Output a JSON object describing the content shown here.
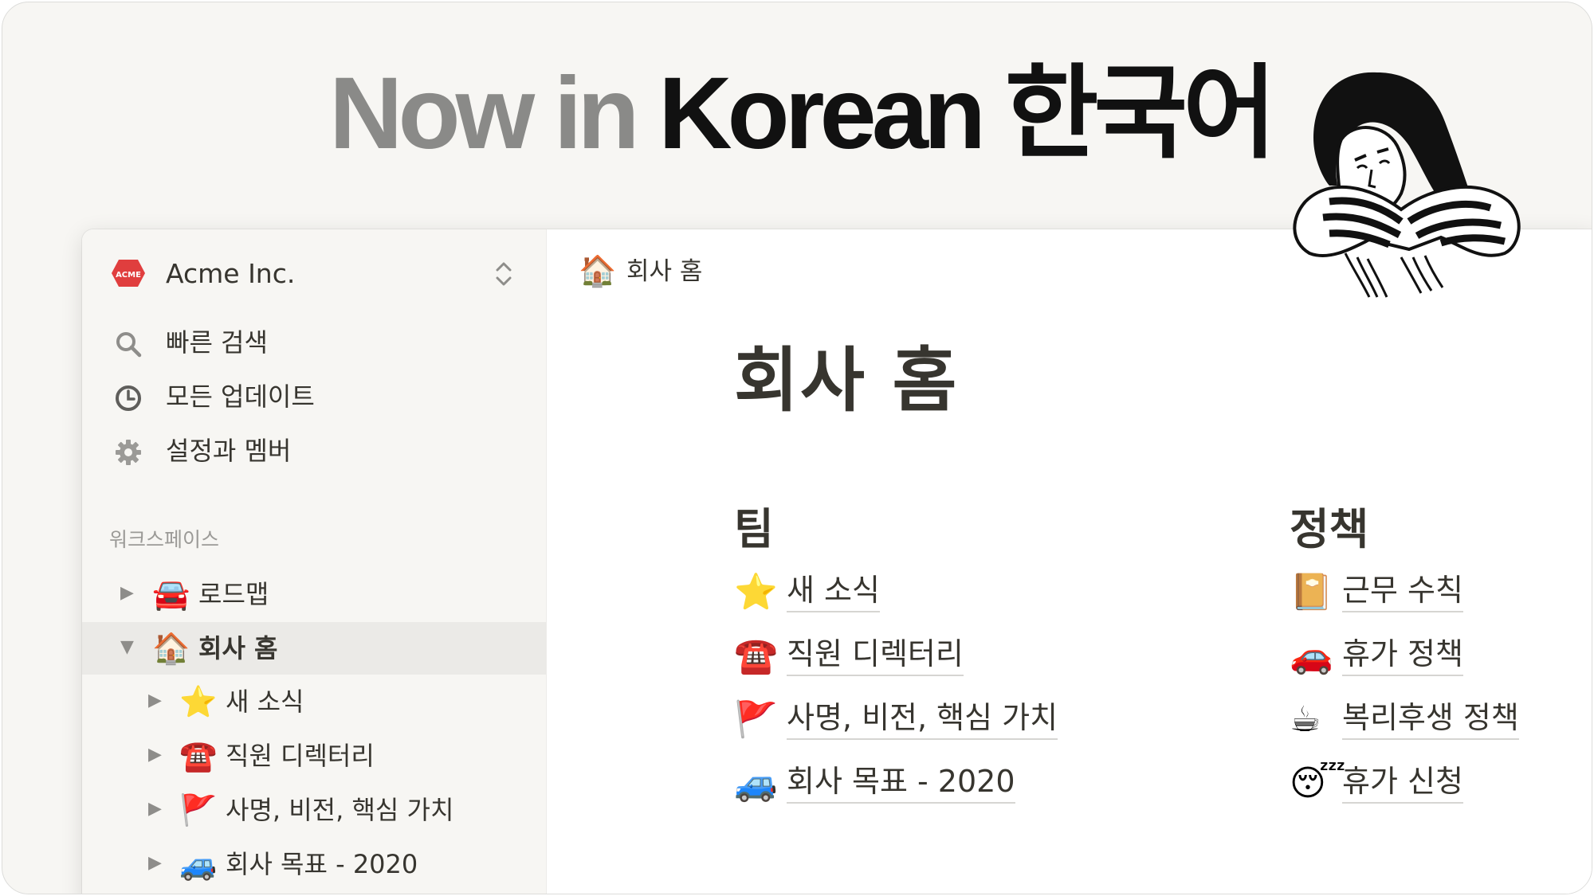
{
  "headline": {
    "part_grey": "Now in ",
    "part_black": "Korean 한국어"
  },
  "workspace": {
    "logo_text": "ACME",
    "name": "Acme Inc."
  },
  "sidebar": {
    "menu": [
      {
        "label": "빠른 검색",
        "icon": "search-icon"
      },
      {
        "label": "모든 업데이트",
        "icon": "clock-icon"
      },
      {
        "label": "설정과 멤버",
        "icon": "gear-icon"
      }
    ],
    "section_label": "워크스페이스",
    "tree": [
      {
        "emoji": "🚘",
        "label": "로드맵",
        "toggle": "▶",
        "active": false
      },
      {
        "emoji": "🏠",
        "label": "회사 홈",
        "toggle": "▼",
        "active": true
      },
      {
        "emoji": "⭐",
        "label": "새 소식",
        "toggle": "▶",
        "active": false
      },
      {
        "emoji": "☎️",
        "label": "직원 디렉터리",
        "toggle": "▶",
        "active": false
      },
      {
        "emoji": "🚩",
        "label": "사명, 비전, 핵심 가치",
        "toggle": "▶",
        "active": false
      },
      {
        "emoji": "🚙",
        "label": "회사 목표 - 2020",
        "toggle": "▶",
        "active": false
      }
    ]
  },
  "breadcrumb": {
    "emoji": "🏠",
    "label": "회사 홈"
  },
  "page": {
    "title": "회사 홈",
    "columns": [
      {
        "heading": "팀",
        "links": [
          {
            "emoji": "⭐",
            "label": "새 소식"
          },
          {
            "emoji": "☎️",
            "label": "직원 디렉터리"
          },
          {
            "emoji": "🚩",
            "label": "사명, 비전, 핵심 가치"
          },
          {
            "emoji": "🚙",
            "label": "회사 목표 - 2020"
          }
        ]
      },
      {
        "heading": "정책",
        "links": [
          {
            "emoji": "📔",
            "label": "근무 수칙"
          },
          {
            "emoji": "🚗",
            "label": "휴가 정책"
          },
          {
            "emoji": "☕",
            "label": "복리후생 정책"
          },
          {
            "emoji": "😴",
            "label": "휴가 신청"
          }
        ]
      }
    ]
  },
  "colors": {
    "background": "#f7f6f3",
    "text": "#37352f",
    "muted": "#9b9a97",
    "active_row": "#ebeae7",
    "acme_red": "#e03e3e"
  }
}
